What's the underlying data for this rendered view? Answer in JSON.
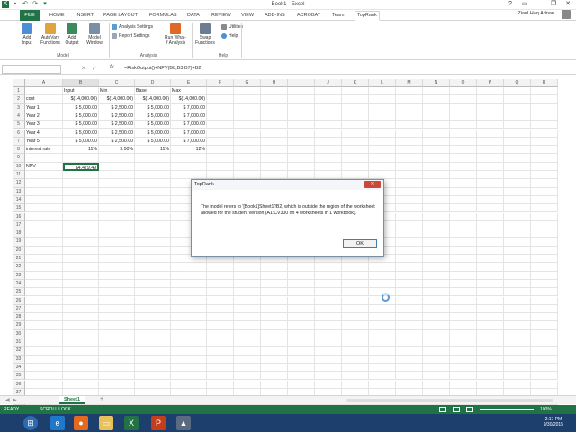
{
  "window": {
    "title": "Book1 - Excel",
    "user": "Ziaul Haq Adnan"
  },
  "tabs": [
    "FILE",
    "HOME",
    "INSERT",
    "PAGE LAYOUT",
    "FORMULAS",
    "DATA",
    "REVIEW",
    "VIEW",
    "ADD-INS",
    "ACROBAT",
    "Team",
    "TopRank"
  ],
  "ribbon": {
    "add_input": "Add\nInput",
    "autovary": "AutoVary\nFunctions",
    "add_output": "Add\nOutput",
    "model_window": "Model\nWindow",
    "analysis_settings": "Analysis Settings",
    "report_settings": "Report Settings",
    "run_whatif": "Run What-\nIf Analysis",
    "swap_functions": "Swap\nFunctions",
    "utilities": "Utilities",
    "help": "Help",
    "group_model": "Model",
    "group_analysis": "Analysis",
    "group_help": "Help"
  },
  "formula_bar": {
    "formula": "=RiskOutput()+NPV(B8,B3:B7)+B2"
  },
  "grid": {
    "columns": [
      "A",
      "B",
      "C",
      "D",
      "E",
      "F",
      "G",
      "H",
      "I",
      "J",
      "K",
      "L",
      "M",
      "N",
      "O",
      "P",
      "Q",
      "R"
    ],
    "rows": [
      "1",
      "2",
      "3",
      "4",
      "5",
      "6",
      "7",
      "8",
      "9",
      "10",
      "11",
      "12",
      "13",
      "14",
      "15",
      "16",
      "17",
      "18",
      "19",
      "20",
      "21",
      "22",
      "23",
      "24",
      "25",
      "26",
      "27",
      "28",
      "29",
      "30",
      "31",
      "32",
      "33",
      "34",
      "35",
      "36",
      "37",
      "38"
    ],
    "cells": [
      [
        "",
        "Input",
        "Min",
        "Base",
        "Max"
      ],
      [
        "cost",
        "$(14,000.00)",
        "$(14,000.00)",
        "$(14,000.00)",
        "$(14,000.00)"
      ],
      [
        "Year 1",
        "$    5,000.00",
        "$    2,500.00",
        "$    5,000.00",
        "$    7,000.00"
      ],
      [
        "Year 2",
        "$    5,000.00",
        "$    2,500.00",
        "$    5,000.00",
        "$    7,000.00"
      ],
      [
        "Year 3",
        "$    5,000.00",
        "$    2,500.00",
        "$    5,000.00",
        "$    7,000.00"
      ],
      [
        "Year 4",
        "$    5,000.00",
        "$    2,500.00",
        "$    5,000.00",
        "$    7,000.00"
      ],
      [
        "Year 5",
        "$    5,000.00",
        "$    2,500.00",
        "$    5,000.00",
        "$    7,000.00"
      ],
      [
        "interest rate",
        "11%",
        "9.50%",
        "11%",
        "12%"
      ],
      [
        "",
        "",
        "",
        "",
        ""
      ],
      [
        "NPV",
        "$4,479.49",
        "",
        "",
        ""
      ]
    ]
  },
  "dialog": {
    "title": "TopRank",
    "close": "✕",
    "message": "The model refers to '[Book1]Sheet1'!B2, which is outside the region of the worksheet allowed for the student version (A1:CV300 on 4 worksheets in 1 workbook).",
    "ok": "OK"
  },
  "sheet": {
    "tab": "Sheet1",
    "add": "+"
  },
  "status": {
    "ready": "READY",
    "scroll_lock": "SCROLL LOCK",
    "zoom": "100%"
  },
  "clock": {
    "time": "2:17 PM",
    "date": "9/30/2015"
  }
}
